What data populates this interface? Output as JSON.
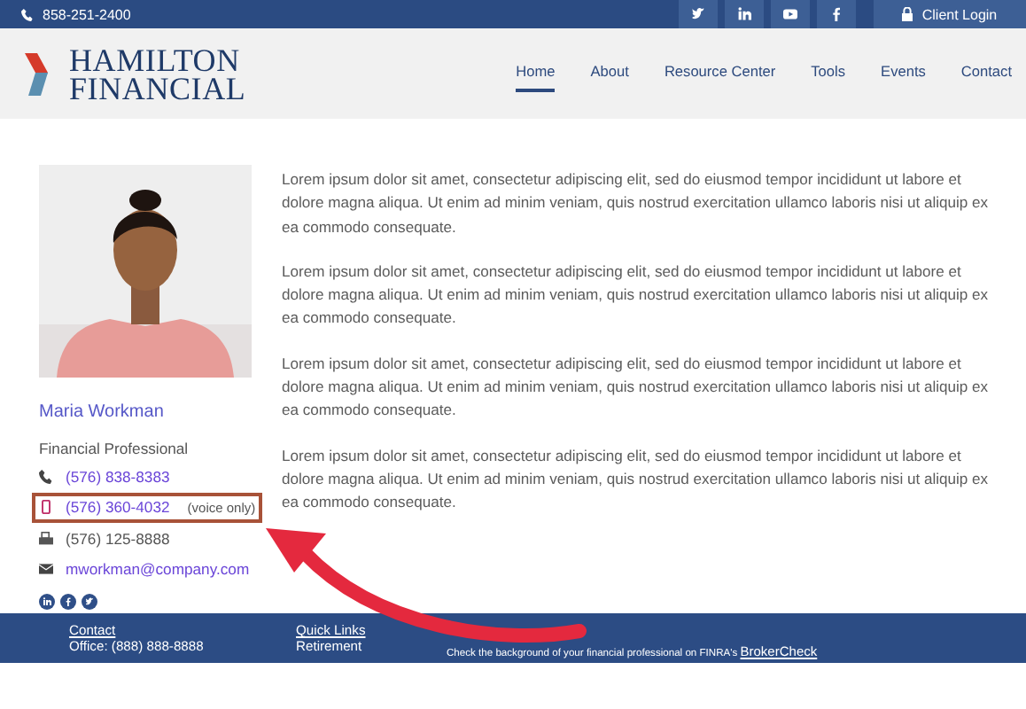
{
  "top_bar": {
    "phone": "858-251-2400",
    "social": [
      {
        "kind": "twitter"
      },
      {
        "kind": "linkedin"
      },
      {
        "kind": "youtube"
      },
      {
        "kind": "facebook"
      }
    ],
    "login": "Client Login"
  },
  "header": {
    "logo": [
      "HAMILTON",
      "FINANCIAL"
    ],
    "nav": [
      {
        "label": "Home",
        "selected": true
      },
      {
        "label": "About",
        "selected": false
      },
      {
        "label": "Resource Center",
        "selected": false
      },
      {
        "label": "Tools",
        "selected": false
      },
      {
        "label": "Events",
        "selected": false
      },
      {
        "label": "Contact",
        "selected": false
      }
    ]
  },
  "profile": {
    "name": "Maria Workman",
    "title": "Financial Professional",
    "contacts": [
      {
        "kind": "phone",
        "text": "(576) 838-8383",
        "link": true,
        "highlighted": false
      },
      {
        "kind": "mobile",
        "text": "(576) 360-4032",
        "note": "(voice only)",
        "link": true,
        "highlighted": true
      },
      {
        "kind": "fax",
        "text": "(576) 125-8888",
        "link": false,
        "highlighted": false
      },
      {
        "kind": "email",
        "text": "mworkman@company.com",
        "link": true,
        "highlighted": false
      }
    ],
    "social": [
      {
        "kind": "linkedin"
      },
      {
        "kind": "facebook"
      },
      {
        "kind": "twitter"
      }
    ]
  },
  "paragraphs": [
    "Lorem ipsum dolor sit amet, consectetur adipiscing elit, sed do eiusmod tempor incididunt ut labore et dolore magna aliqua. Ut enim ad minim veniam, quis nostrud exercitation ullamco laboris nisi ut aliquip ex ea commodo consequate.",
    "Lorem ipsum dolor sit amet, consectetur adipiscing elit, sed do eiusmod tempor incididunt ut labore et dolore magna aliqua. Ut enim ad minim veniam, quis nostrud exercitation ullamco laboris nisi ut aliquip ex ea commodo consequate.",
    "Lorem ipsum dolor sit amet, consectetur adipiscing elit, sed do eiusmod tempor incididunt ut labore et dolore magna aliqua. Ut enim ad minim veniam, quis nostrud exercitation ullamco laboris nisi ut aliquip ex ea commodo consequate.",
    "Lorem ipsum dolor sit amet, consectetur adipiscing elit, sed do eiusmod tempor incididunt ut labore et dolore magna aliqua. Ut enim ad minim veniam, quis nostrud exercitation ullamco laboris nisi ut aliquip ex ea commodo consequate."
  ],
  "footer": {
    "columns": [
      {
        "heading": "Contact",
        "lines": [
          "Office: (888) 888-8888"
        ]
      },
      {
        "heading": "Quick Links",
        "lines": [
          "Retirement"
        ]
      }
    ],
    "finra": {
      "text": "Check the background of your financial professional on FINRA's",
      "link": "BrokerCheck"
    }
  }
}
